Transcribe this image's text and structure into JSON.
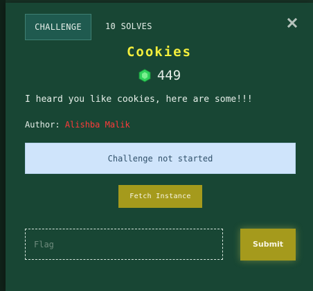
{
  "header": {
    "tabs": [
      {
        "label": "CHALLENGE",
        "active": true
      },
      {
        "label": "10 SOLVES",
        "active": false
      }
    ],
    "close_icon": "close-icon"
  },
  "challenge": {
    "title": "Cookies",
    "points_icon": "gem-icon",
    "points": "449",
    "description": "I heard you like cookies, here are some!!!",
    "author_label": "Author:",
    "author_name": "Alishba Malik"
  },
  "instance": {
    "status_text": "Challenge not started",
    "fetch_label": "Fetch Instance"
  },
  "flag_form": {
    "placeholder": "Flag",
    "value": "",
    "submit_label": "Submit"
  },
  "colors": {
    "background": "#184634",
    "title": "#f4ef3c",
    "accent_button": "#a59a1c",
    "author_name": "#ff3b3b",
    "status_box": "#cfe4fb",
    "gem": "#2fd15a"
  }
}
